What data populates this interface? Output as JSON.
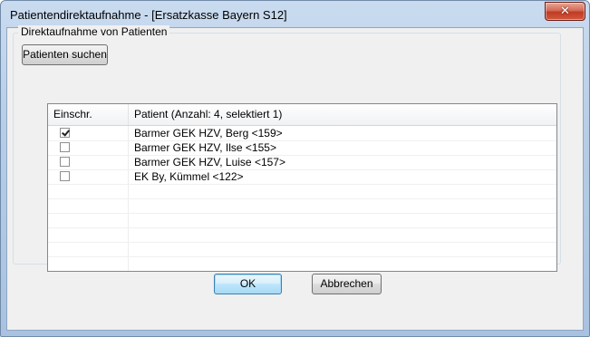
{
  "window": {
    "title": "Patientendirektaufnahme - [Ersatzkasse Bayern S12]",
    "close_glyph": "✕"
  },
  "group": {
    "label": "Direktaufnahme von Patienten",
    "search_button": "Patienten suchen"
  },
  "list": {
    "columns": [
      "Einschr.",
      "Patient (Anzahl: 4, selektiert 1)"
    ],
    "rows": [
      {
        "checked": true,
        "patient": "Barmer GEK HZV,  Berg <159>"
      },
      {
        "checked": false,
        "patient": "Barmer GEK HZV,  Ilse <155>"
      },
      {
        "checked": false,
        "patient": "Barmer GEK HZV,  Luise <157>"
      },
      {
        "checked": false,
        "patient": "EK By,  Kümmel <122>"
      }
    ]
  },
  "buttons": {
    "ok": "OK",
    "cancel": "Abbrechen"
  }
}
